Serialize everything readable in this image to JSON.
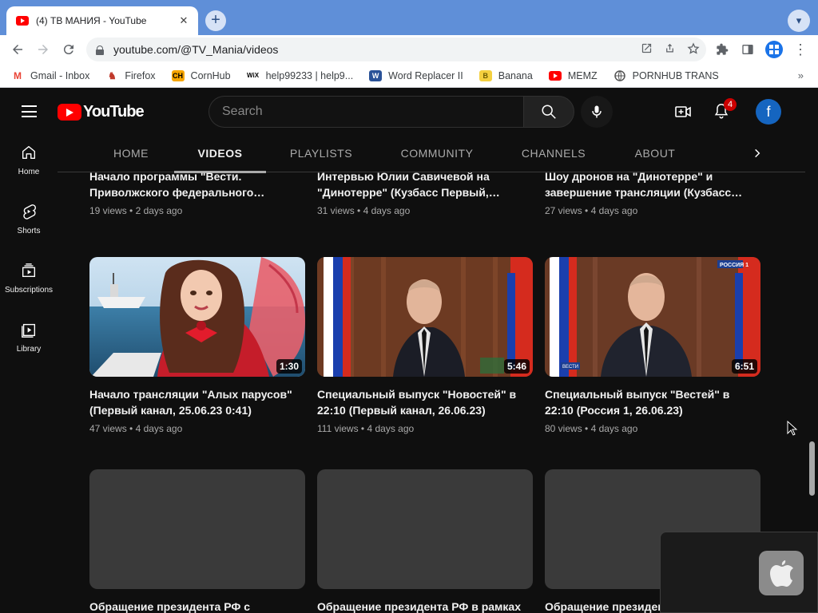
{
  "browser": {
    "tab_title": "(4) ТВ МАНИЯ - YouTube",
    "url": "youtube.com/@TV_Mania/videos",
    "bookmarks": [
      {
        "label": "Gmail - Inbox",
        "icon": "gmail-icon",
        "color": "#ea4335"
      },
      {
        "label": "Firefox",
        "icon": "firefox-icon",
        "color": "#c0392b"
      },
      {
        "label": "CornHub",
        "icon": "cornhub-icon",
        "color": "#f7a600"
      },
      {
        "label": "help99233 | help9...",
        "icon": "wix-icon",
        "color": "#000000"
      },
      {
        "label": "Word Replacer II",
        "icon": "word-replacer-icon",
        "color": "#2a5298"
      },
      {
        "label": "Banana",
        "icon": "banana-icon",
        "color": "#f4d03f"
      },
      {
        "label": "MEMZ",
        "icon": "youtube-icon",
        "color": "#ff0000"
      },
      {
        "label": "PORNHUB TRANS",
        "icon": "globe-icon",
        "color": "#555555"
      }
    ]
  },
  "youtube": {
    "logo_text": "YouTube",
    "search_placeholder": "Search",
    "notification_count": "4",
    "avatar_letter": "f",
    "sidebar": [
      {
        "label": "Home",
        "icon": "home-icon"
      },
      {
        "label": "Shorts",
        "icon": "shorts-icon"
      },
      {
        "label": "Subscriptions",
        "icon": "subscriptions-icon"
      },
      {
        "label": "Library",
        "icon": "library-icon"
      }
    ],
    "tabs": [
      {
        "label": "HOME"
      },
      {
        "label": "VIDEOS"
      },
      {
        "label": "PLAYLISTS"
      },
      {
        "label": "COMMUNITY"
      },
      {
        "label": "CHANNELS"
      },
      {
        "label": "ABOUT"
      }
    ],
    "active_tab": "VIDEOS",
    "videos_row1": [
      {
        "title": "Начало программы \"Вести. Приволжского федерального…",
        "views": "19 views",
        "age": "2 days ago"
      },
      {
        "title": "Интервью Юлии Савичевой на \"Динотерре\" (Кузбасс Первый,…",
        "views": "31 views",
        "age": "4 days ago"
      },
      {
        "title": "Шоу дронов на \"Динотерре\" и завершение трансляции (Кузбасс…",
        "views": "27 views",
        "age": "4 days ago"
      }
    ],
    "videos_row2": [
      {
        "title": "Начало трансляции \"Алых парусов\" (Первый канал, 25.06.23 0:41)",
        "views": "47 views",
        "age": "4 days ago",
        "duration": "1:30"
      },
      {
        "title": "Специальный выпуск \"Новостей\" в 22:10 (Первый канал, 26.06.23)",
        "views": "111 views",
        "age": "4 days ago",
        "duration": "5:46"
      },
      {
        "title": "Специальный выпуск \"Вестей\" в 22:10 (Россия 1, 26.06.23)",
        "views": "80 views",
        "age": "4 days ago",
        "duration": "6:51",
        "channel_logo": "РОССИЯ 1",
        "watermark": "ВЕСТИ"
      }
    ],
    "videos_row3": [
      {
        "title": "Обращение президента РФ с"
      },
      {
        "title": "Обращение президента РФ в рамках"
      },
      {
        "title": "Обращение президен"
      }
    ]
  }
}
